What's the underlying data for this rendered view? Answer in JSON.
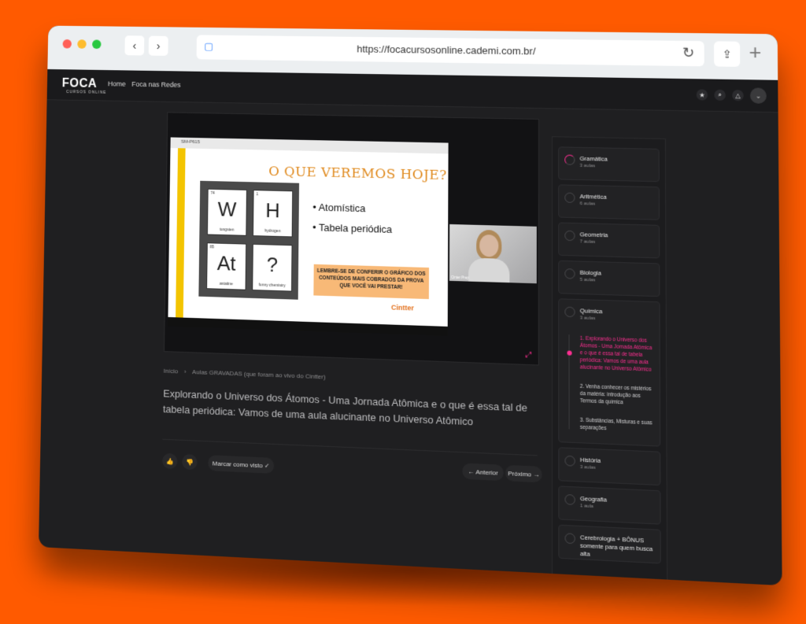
{
  "browser": {
    "url": "https://focacursosonline.cademi.com.br/",
    "back_icon": "chevron-left-icon",
    "forward_icon": "chevron-right-icon"
  },
  "header": {
    "logo": "FOCA",
    "logo_sub": "CURSOS ONLINE",
    "nav": [
      "Home",
      "Foca nas Redes"
    ]
  },
  "video": {
    "window_title": "SM-P615",
    "slide_title": "O QUE VEREMOS HOJE?",
    "elements": [
      {
        "num": "74",
        "sym": "W",
        "name": "tungsten"
      },
      {
        "num": "1",
        "sym": "H",
        "name": "hydrogen"
      },
      {
        "num": "85",
        "sym": "At",
        "name": "astatine"
      },
      {
        "num": "",
        "sym": "?",
        "name": "funny chemistry"
      }
    ],
    "bullets": [
      "• Atomística",
      "• Tabela periódica"
    ],
    "note": "LEMBRE-SE DE CONFERIR O GRÁFICO DOS CONTEÚDOS MAIS COBRADOS DA PROVA QUE VOCÊ VAI PRESTAR!",
    "brand": "Cintter",
    "camera_name": "Cinter Prep"
  },
  "breadcrumb": {
    "home": "Início",
    "separator": "›",
    "section": "Aulas GRAVADAS (que foram ao vivo do Cintter)"
  },
  "lesson": {
    "title": "Explorando o Universo dos Átomos - Uma Jornada Atômica e o que é essa tal de tabela periódica: Vamos de uma aula alucinante no Universo Atômico"
  },
  "actions": {
    "like": "👍",
    "dislike": "👎",
    "mark_seen": "Marcar como visto ✓",
    "previous": "← Anterior",
    "next": "Próximo →"
  },
  "modules": [
    {
      "title": "Gramática",
      "sub": "3 aulas"
    },
    {
      "title": "Aritmética",
      "sub": "6 aulas"
    },
    {
      "title": "Geometria",
      "sub": "7 aulas"
    },
    {
      "title": "Biologia",
      "sub": "5 aulas"
    },
    {
      "title": "Química",
      "sub": "3 aulas"
    },
    {
      "title": "História",
      "sub": "3 aulas"
    },
    {
      "title": "Geografia",
      "sub": "1 aula"
    },
    {
      "title": "Cerebrologia + BÔNUS somente para quem busca alta",
      "sub": ""
    }
  ],
  "chemistry_lessons": [
    "1. Explorando o Universo dos Átomos - Uma Jornada Atômica e o que é essa tal de tabela periódica: Vamos de uma aula alucinante no Universo Atômico",
    "2. Venha conhecer os mistérios da matéria: introdução aos Termos da química",
    "3. Substâncias, Misturas e suas separações"
  ],
  "colors": {
    "accent": "#ff2f92",
    "background": "#ff5a00"
  }
}
